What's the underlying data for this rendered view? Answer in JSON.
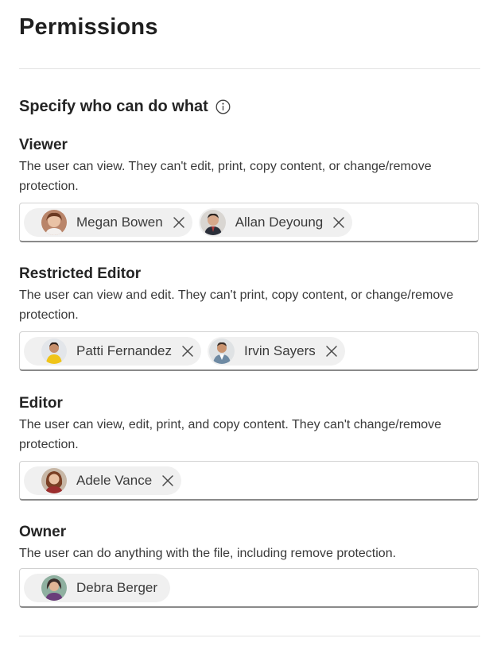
{
  "header": {
    "title": "Permissions"
  },
  "intro": {
    "heading": "Specify who can do what",
    "info_icon": "info-icon"
  },
  "roles": [
    {
      "title": "Viewer",
      "description": "The user can view. They can't edit, print, copy content, or change/remove protection.",
      "people": [
        {
          "name": "Megan Bowen",
          "removable": true
        },
        {
          "name": "Allan Deyoung",
          "removable": true
        }
      ]
    },
    {
      "title": "Restricted Editor",
      "description": "The user can view and edit. They can't print, copy content, or change/remove protection.",
      "people": [
        {
          "name": "Patti Fernandez",
          "removable": true
        },
        {
          "name": "Irvin Sayers",
          "removable": true
        }
      ]
    },
    {
      "title": "Editor",
      "description": "The user can view, edit, print, and copy content. They can't change/remove protection.",
      "people": [
        {
          "name": "Adele Vance",
          "removable": true
        }
      ]
    },
    {
      "title": "Owner",
      "description": "The user can do anything with the file, including remove protection.",
      "people": [
        {
          "name": "Debra Berger",
          "removable": false
        }
      ]
    }
  ],
  "colors": {
    "chip_bg": "#f0f0f0",
    "border": "#d1d1d1",
    "border_bottom": "#8a8a8a"
  }
}
